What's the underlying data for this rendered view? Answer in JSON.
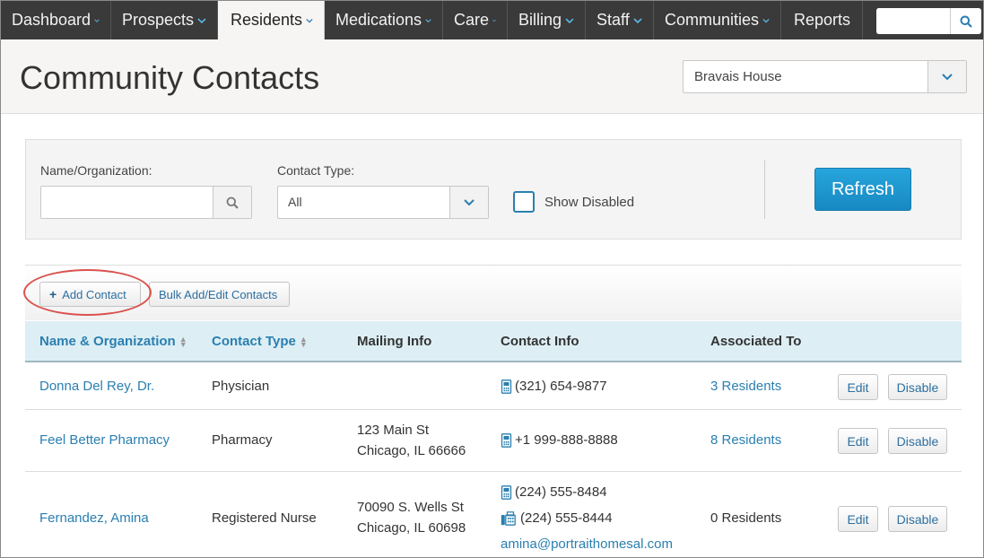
{
  "nav": {
    "items": [
      {
        "label": "Dashboard",
        "dropdown": true
      },
      {
        "label": "Prospects",
        "dropdown": true
      },
      {
        "label": "Residents",
        "dropdown": true,
        "active": true
      },
      {
        "label": "Medications",
        "dropdown": true
      },
      {
        "label": "Care",
        "dropdown": true
      },
      {
        "label": "Billing",
        "dropdown": true
      },
      {
        "label": "Staff",
        "dropdown": true
      },
      {
        "label": "Communities",
        "dropdown": true
      },
      {
        "label": "Reports",
        "dropdown": false
      }
    ],
    "search_value": ""
  },
  "header": {
    "title": "Community Contacts",
    "community": "Bravais House"
  },
  "filters": {
    "name_label": "Name/Organization:",
    "name_value": "",
    "type_label": "Contact Type:",
    "type_value": "All",
    "show_disabled_label": "Show Disabled",
    "show_disabled_checked": false,
    "refresh_label": "Refresh"
  },
  "toolbar": {
    "add_contact": "Add Contact",
    "bulk_edit": "Bulk Add/Edit Contacts"
  },
  "table": {
    "headers": {
      "name": "Name & Organization",
      "type": "Contact Type",
      "mailing": "Mailing Info",
      "contact": "Contact Info",
      "associated": "Associated To"
    },
    "edit_label": "Edit",
    "disable_label": "Disable",
    "rows": [
      {
        "name": "Donna Del Rey, Dr.",
        "type": "Physician",
        "mailing_line1": "",
        "mailing_line2": "",
        "phone": "(321) 654-9877",
        "fax": "",
        "email": "",
        "associated": "3 Residents"
      },
      {
        "name": "Feel Better Pharmacy",
        "type": "Pharmacy",
        "mailing_line1": "123 Main St",
        "mailing_line2": "Chicago, IL 66666",
        "phone": "+1 999-888-8888",
        "fax": "",
        "email": "",
        "associated": "8 Residents"
      },
      {
        "name": "Fernandez, Amina",
        "type": "Registered Nurse",
        "mailing_line1": "70090 S. Wells St",
        "mailing_line2": "Chicago, IL 60698",
        "phone": "(224) 555-8484",
        "fax": "(224) 555-8444",
        "email": "amina@portraithomesal.com",
        "associated": "0 Residents"
      }
    ]
  }
}
